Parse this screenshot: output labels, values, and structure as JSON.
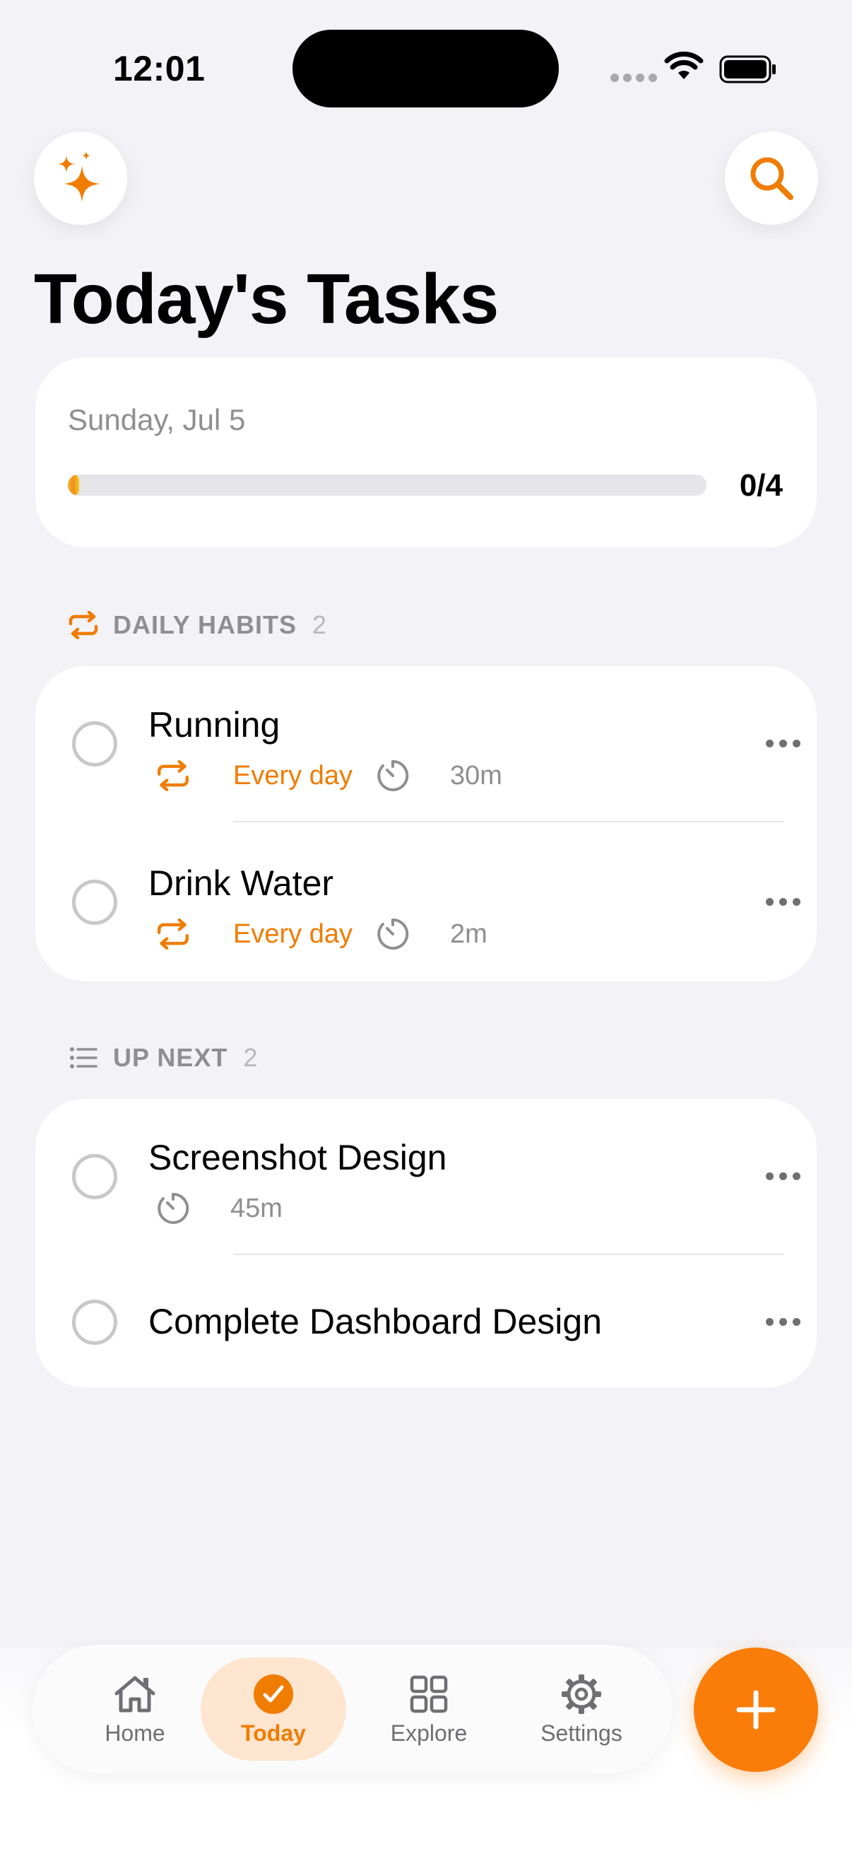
{
  "status_bar": {
    "time": "12:01"
  },
  "header": {
    "title": "Today's Tasks"
  },
  "progress": {
    "date": "Sunday, Jul 5",
    "completed_label": "0/4",
    "fraction": 0.0
  },
  "sections": {
    "daily_habits": {
      "label": "DAILY HABITS",
      "count": "2",
      "tasks": [
        {
          "title": "Running",
          "repeat": "Every day",
          "duration": "30m"
        },
        {
          "title": "Drink Water",
          "repeat": "Every day",
          "duration": "2m"
        }
      ]
    },
    "up_next": {
      "label": "UP NEXT",
      "count": "2",
      "tasks": [
        {
          "title": "Screenshot Design",
          "duration": "45m"
        },
        {
          "title": "Complete Dashboard Design"
        }
      ]
    }
  },
  "tab_bar": {
    "home": "Home",
    "today": "Today",
    "explore": "Explore",
    "settings": "Settings"
  },
  "colors": {
    "accent": "#F07C00",
    "fab": "#FA7D0A",
    "background": "#F2F2F7",
    "muted": "#8E8E93"
  },
  "icons": {
    "header_left": "sparkles-icon",
    "header_right": "search-icon",
    "habits_section": "repeat-icon",
    "upnext_section": "list-icon",
    "fab": "plus-icon"
  }
}
